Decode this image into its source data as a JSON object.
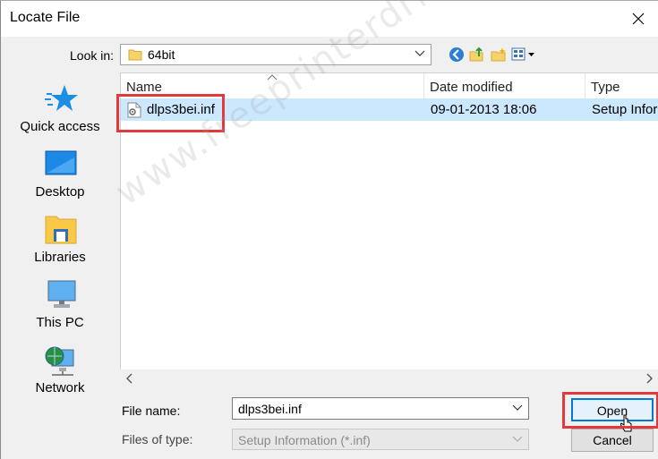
{
  "window": {
    "title": "Locate File"
  },
  "lookin": {
    "label": "Look in:",
    "value": "64bit"
  },
  "places": [
    {
      "label": "Quick access",
      "icon": "star-icon"
    },
    {
      "label": "Desktop",
      "icon": "desktop-icon"
    },
    {
      "label": "Libraries",
      "icon": "libraries-icon"
    },
    {
      "label": "This PC",
      "icon": "computer-icon"
    },
    {
      "label": "Network",
      "icon": "network-icon"
    }
  ],
  "columns": {
    "name": "Name",
    "date": "Date modified",
    "type": "Type"
  },
  "files": [
    {
      "name": "dlps3bei.inf",
      "date": "09-01-2013 18:06",
      "type": "Setup Inforn"
    }
  ],
  "filename": {
    "label": "File name:",
    "value": "dlps3bei.inf"
  },
  "filetype": {
    "label": "Files of type:",
    "value": "Setup Information (*.inf)"
  },
  "buttons": {
    "open": "Open",
    "cancel": "Cancel"
  },
  "watermark": "www.freeprinterdriverdownload.org",
  "colors": {
    "selection": "#cce8ff",
    "highlight": "#e0393e",
    "accent": "#0078d7"
  }
}
